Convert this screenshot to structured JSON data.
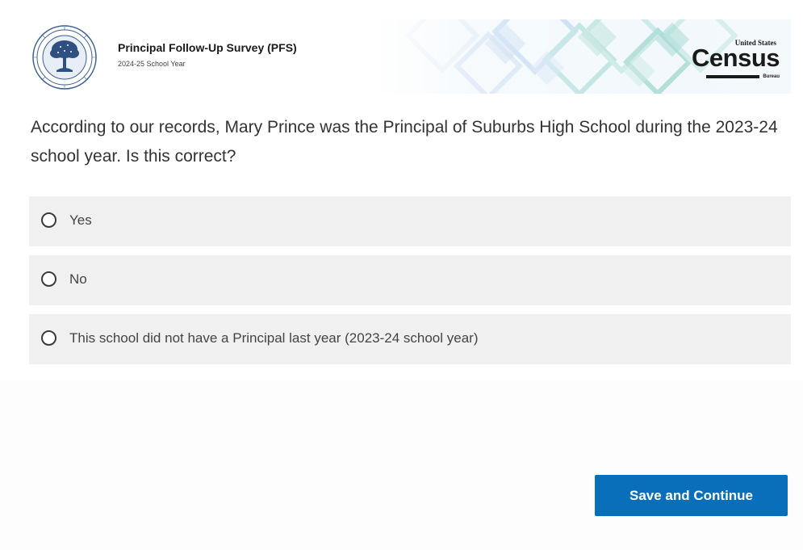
{
  "header": {
    "survey_title": "Principal Follow-Up Survey (PFS)",
    "survey_year": "2024-25 School Year",
    "logo": {
      "top_text": "United States",
      "word": "Census",
      "bottom_text": "Bureau"
    },
    "seal_icon": "department-of-education-seal"
  },
  "question": {
    "text": "According to our records, Mary Prince was the Principal of Suburbs High School during the 2023-24 school year. Is this correct?"
  },
  "options": [
    {
      "label": "Yes",
      "selected": false
    },
    {
      "label": "No",
      "selected": false
    },
    {
      "label": "This school did not have a Principal last year (2023-24 school year)",
      "selected": false
    }
  ],
  "actions": {
    "save_continue_label": "Save and Continue"
  },
  "colors": {
    "primary_button": "#0a6fbb",
    "option_background": "#f0f0f0",
    "text": "#333333"
  }
}
